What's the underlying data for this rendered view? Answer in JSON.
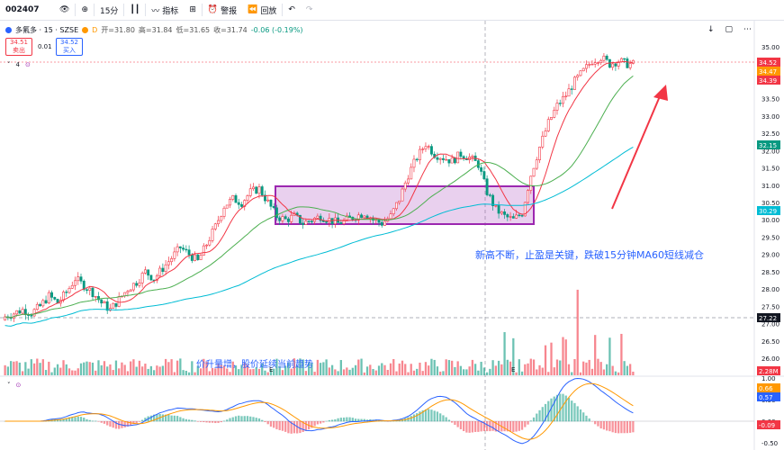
{
  "toolbar": {
    "symbol": "002407",
    "interval": "15分",
    "indicators_label": "指标",
    "alert_label": "警报",
    "replay_label": "回放"
  },
  "legend": {
    "title": "多氟多 · 15 · SZSE",
    "badge": "D",
    "open": "开=31.80",
    "high": "高=31.84",
    "low": "低=31.65",
    "close": "收=31.74",
    "change": "-0.06 (-0.19%)",
    "indicator_count": "4"
  },
  "quote": {
    "sell_price": "34.51",
    "sell_label": "卖出",
    "spread": "0.01",
    "buy_price": "34.52",
    "buy_label": "买入"
  },
  "annotations": {
    "main_text": "新高不断，止盈是关键，跌破15分钟MA60短线减仓",
    "volume_text": "价升量增，股价延续当前趋势",
    "earnings_marker": "E"
  },
  "price_axis": {
    "ticks": [
      "35.00",
      "34.50",
      "34.00",
      "33.50",
      "33.00",
      "32.50",
      "32.00",
      "31.50",
      "31.00",
      "30.50",
      "30.00",
      "29.50",
      "29.00",
      "28.50",
      "28.00",
      "27.50",
      "27.00",
      "26.50",
      "26.00"
    ],
    "tags": [
      {
        "text": "34.52",
        "color": "#f23645"
      },
      {
        "text": "34.47",
        "color": "#ff9800"
      },
      {
        "text": "34.39",
        "color": "#f23645"
      },
      {
        "text": "32.15",
        "color": "#089981"
      },
      {
        "text": "30.29",
        "color": "#00bcd4"
      },
      {
        "text": "27.22",
        "color": "#131722"
      },
      {
        "text": "2.28M",
        "color": "#f23645"
      }
    ]
  },
  "macd_axis": {
    "ticks": [
      "1.00",
      "0.50",
      "0.00",
      "-0.50"
    ],
    "tags": [
      {
        "text": "0.66",
        "color": "#ff9800"
      },
      {
        "text": "0.57",
        "color": "#2962ff"
      },
      {
        "text": "-0.09",
        "color": "#f23645"
      }
    ]
  },
  "colors": {
    "up": "#f23645",
    "down": "#089981",
    "ma_short": "#f23645",
    "ma_mid": "#4caf50",
    "ma_long": "#00bcd4",
    "box": "#9c27b0",
    "arrow": "#f23645",
    "annotation": "#2962ff"
  },
  "chart_data": {
    "type": "candlestick",
    "price_range": [
      26.0,
      35.0
    ],
    "close_series": [
      27.2,
      27.3,
      27.4,
      27.3,
      27.5,
      27.8,
      27.6,
      27.9,
      28.3,
      28.1,
      27.9,
      27.6,
      27.4,
      27.7,
      28.0,
      28.2,
      28.5,
      28.3,
      28.6,
      28.9,
      29.2,
      29.0,
      28.8,
      29.3,
      29.8,
      30.4,
      30.6,
      30.5,
      30.8,
      30.9,
      30.5,
      30.1,
      30.0,
      30.1,
      29.9,
      30.0,
      30.1,
      30.0,
      29.9,
      30.0,
      30.1,
      30.2,
      30.0,
      29.9,
      30.1,
      30.6,
      31.3,
      31.8,
      32.2,
      31.9,
      31.8,
      31.7,
      31.9,
      31.8,
      31.6,
      30.8,
      30.3,
      30.1,
      30.0,
      30.2,
      31.3,
      32.1,
      32.8,
      33.3,
      33.6,
      34.0,
      34.3,
      34.6,
      34.7,
      34.5,
      34.6,
      34.5
    ],
    "macd_range": [
      -0.5,
      1.0
    ]
  }
}
